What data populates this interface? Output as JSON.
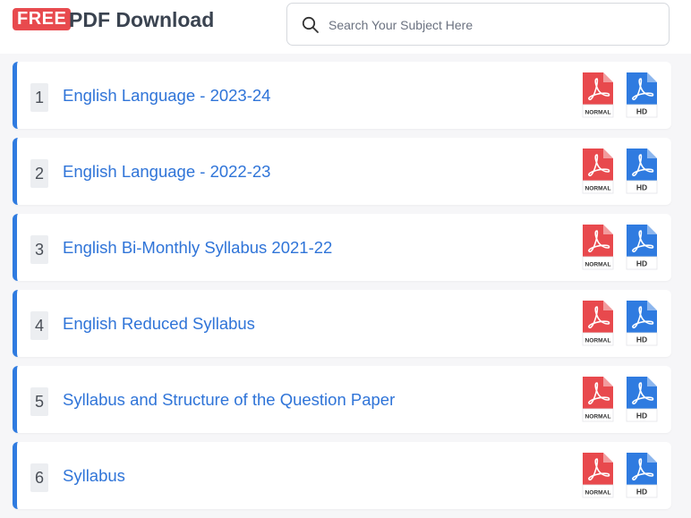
{
  "header": {
    "badge": "FREE",
    "title": "PDF Download",
    "search": {
      "placeholder": "Search Your Subject Here",
      "value": ""
    }
  },
  "download_labels": {
    "normal": "NORMAL",
    "hd": "HD"
  },
  "colors": {
    "accent": "#2f7be0",
    "badge": "#e84a4e",
    "pdf_normal": "#e8494d",
    "pdf_hd": "#2f7be0"
  },
  "items": [
    {
      "num": "1",
      "title": "English Language - 2023-24"
    },
    {
      "num": "2",
      "title": "English Language - 2022-23"
    },
    {
      "num": "3",
      "title": "English Bi-Monthly Syllabus 2021-22"
    },
    {
      "num": "4",
      "title": "English Reduced Syllabus"
    },
    {
      "num": "5",
      "title": "Syllabus and Structure of the Question Paper"
    },
    {
      "num": "6",
      "title": "Syllabus"
    }
  ]
}
